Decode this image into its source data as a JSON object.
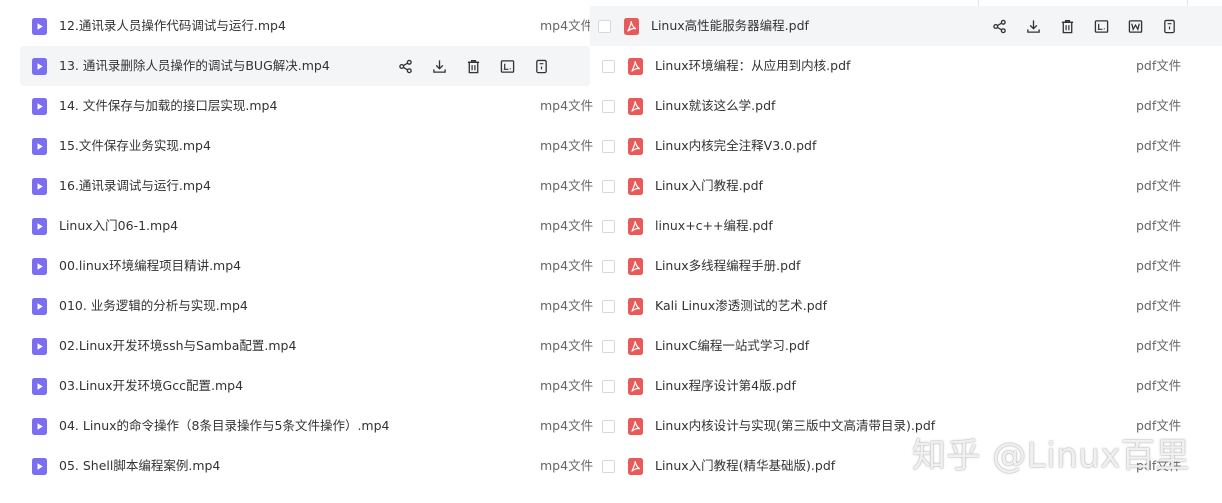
{
  "colors": {
    "video_icon": "#7c6ef2",
    "pdf_icon": "#e85a5a",
    "hover_bg": "#f4f5f7",
    "text": "#333333",
    "type_text": "#666666"
  },
  "left_files": [
    {
      "name": "12.通讯录人员操作代码调试与运行.mp4",
      "type": "mp4文件",
      "icon": "video-file-icon"
    },
    {
      "name": "13. 通讯录删除人员操作的调试与BUG解决.mp4",
      "type": "",
      "icon": "video-file-icon",
      "hover": true
    },
    {
      "name": "14. 文件保存与加载的接口层实现.mp4",
      "type": "mp4文件",
      "icon": "video-file-icon"
    },
    {
      "name": "15.文件保存业务实现.mp4",
      "type": "mp4文件",
      "icon": "video-file-icon"
    },
    {
      "name": "16.通讯录调试与运行.mp4",
      "type": "mp4文件",
      "icon": "video-file-icon"
    },
    {
      "name": "Linux入门06-1.mp4",
      "type": "mp4文件",
      "icon": "video-file-icon"
    },
    {
      "name": "00.linux环境编程项目精讲.mp4",
      "type": "mp4文件",
      "icon": "video-file-icon"
    },
    {
      "name": "010. 业务逻辑的分析与实现.mp4",
      "type": "mp4文件",
      "icon": "video-file-icon"
    },
    {
      "name": "02.Linux开发环境ssh与Samba配置.mp4",
      "type": "mp4文件",
      "icon": "video-file-icon"
    },
    {
      "name": "03.Linux开发环境Gcc配置.mp4",
      "type": "mp4文件",
      "icon": "video-file-icon"
    },
    {
      "name": "04. Linux的命令操作（8条目录操作与5条文件操作）.mp4",
      "type": "mp4文件",
      "icon": "video-file-icon"
    },
    {
      "name": "05. Shell脚本编程案例.mp4",
      "type": "mp4文件",
      "icon": "video-file-icon"
    }
  ],
  "right_files": [
    {
      "name": "Linux高性能服务器编程.pdf",
      "type": "",
      "icon": "pdf-file-icon",
      "hover": true
    },
    {
      "name": "Linux环境编程：从应用到内核.pdf",
      "type": "pdf文件",
      "icon": "pdf-file-icon"
    },
    {
      "name": "Linux就该这么学.pdf",
      "type": "pdf文件",
      "icon": "pdf-file-icon"
    },
    {
      "name": "Linux内核完全注释V3.0.pdf",
      "type": "pdf文件",
      "icon": "pdf-file-icon"
    },
    {
      "name": "Linux入门教程.pdf",
      "type": "pdf文件",
      "icon": "pdf-file-icon"
    },
    {
      "name": "linux+c++编程.pdf",
      "type": "pdf文件",
      "icon": "pdf-file-icon"
    },
    {
      "name": "Linux多线程编程手册.pdf",
      "type": "pdf文件",
      "icon": "pdf-file-icon"
    },
    {
      "name": "Kali Linux渗透测试的艺术.pdf",
      "type": "pdf文件",
      "icon": "pdf-file-icon"
    },
    {
      "name": "LinuxC编程一站式学习.pdf",
      "type": "pdf文件",
      "icon": "pdf-file-icon"
    },
    {
      "name": "Linux程序设计第4版.pdf",
      "type": "pdf文件",
      "icon": "pdf-file-icon"
    },
    {
      "name": "Linux内核设计与实现(第三版中文高清带目录).pdf",
      "type": "pdf文件",
      "icon": "pdf-file-icon"
    },
    {
      "name": "Linux入门教程(精华基础版).pdf",
      "type": "pdf文件",
      "icon": "pdf-file-icon"
    }
  ],
  "left_hover_actions": [
    "share-icon",
    "download-icon",
    "delete-icon",
    "rename-icon",
    "more-info-icon"
  ],
  "right_hover_actions": [
    "share-icon",
    "download-icon",
    "delete-icon",
    "rename-icon",
    "open-with-word-icon",
    "more-info-icon"
  ],
  "watermark": "知乎 @Linux百里"
}
